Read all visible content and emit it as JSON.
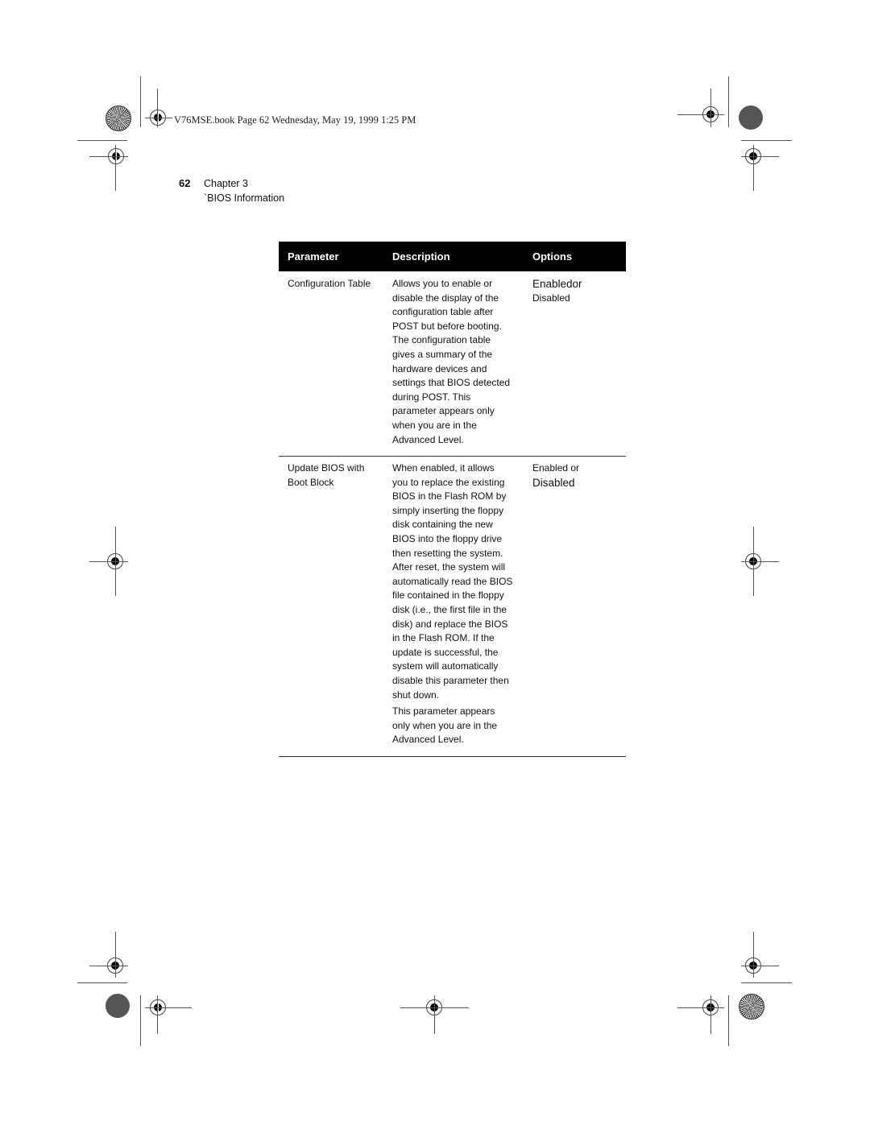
{
  "print_header": "V76MSE.book  Page 62  Wednesday, May 19, 1999  1:25 PM",
  "page_number": "62",
  "chapter": {
    "label": "Chapter 3",
    "section": "`BIOS Information"
  },
  "table": {
    "headers": [
      "Parameter",
      "Description",
      "Options"
    ],
    "rows": [
      {
        "parameter": [
          "Configuration Table"
        ],
        "description": [
          "Allows you to enable or",
          "disable the display of the",
          "configuration table after",
          "POST but before booting.",
          "The configuration table",
          "gives a summary of the",
          "hardware devices and",
          "settings that BIOS detected",
          "during POST.  This",
          "parameter appears only",
          "when you are in the",
          "Advanced Level."
        ],
        "description_extra": [],
        "options": [
          "Enabledor",
          "Disabled"
        ]
      },
      {
        "parameter": [
          "Update BIOS with",
          "Boot Block"
        ],
        "description": [
          "When enabled, it allows",
          "you to replace the existing",
          "BIOS in the Flash ROM by",
          "simply inserting the floppy",
          "disk containing the new",
          "BIOS into the floppy drive",
          "then resetting the system.",
          "After reset, the system will",
          "automatically read the BIOS",
          "file contained in the floppy",
          "disk (i.e., the first file in the",
          "disk) and replace the BIOS",
          "in the Flash ROM.  If the",
          "update is successful, the",
          "system will automatically",
          "disable this parameter then",
          "shut down."
        ],
        "description_extra": [
          "This parameter appears",
          "only when you are in the",
          "Advanced Level."
        ],
        "options": [
          "Enabled or",
          "Disabled"
        ]
      }
    ]
  },
  "marks": {
    "registration_icon": "crosshair-registration-mark",
    "color_bar_icon": "starburst-target",
    "gray_disc_icon": "gray-density-disc"
  }
}
